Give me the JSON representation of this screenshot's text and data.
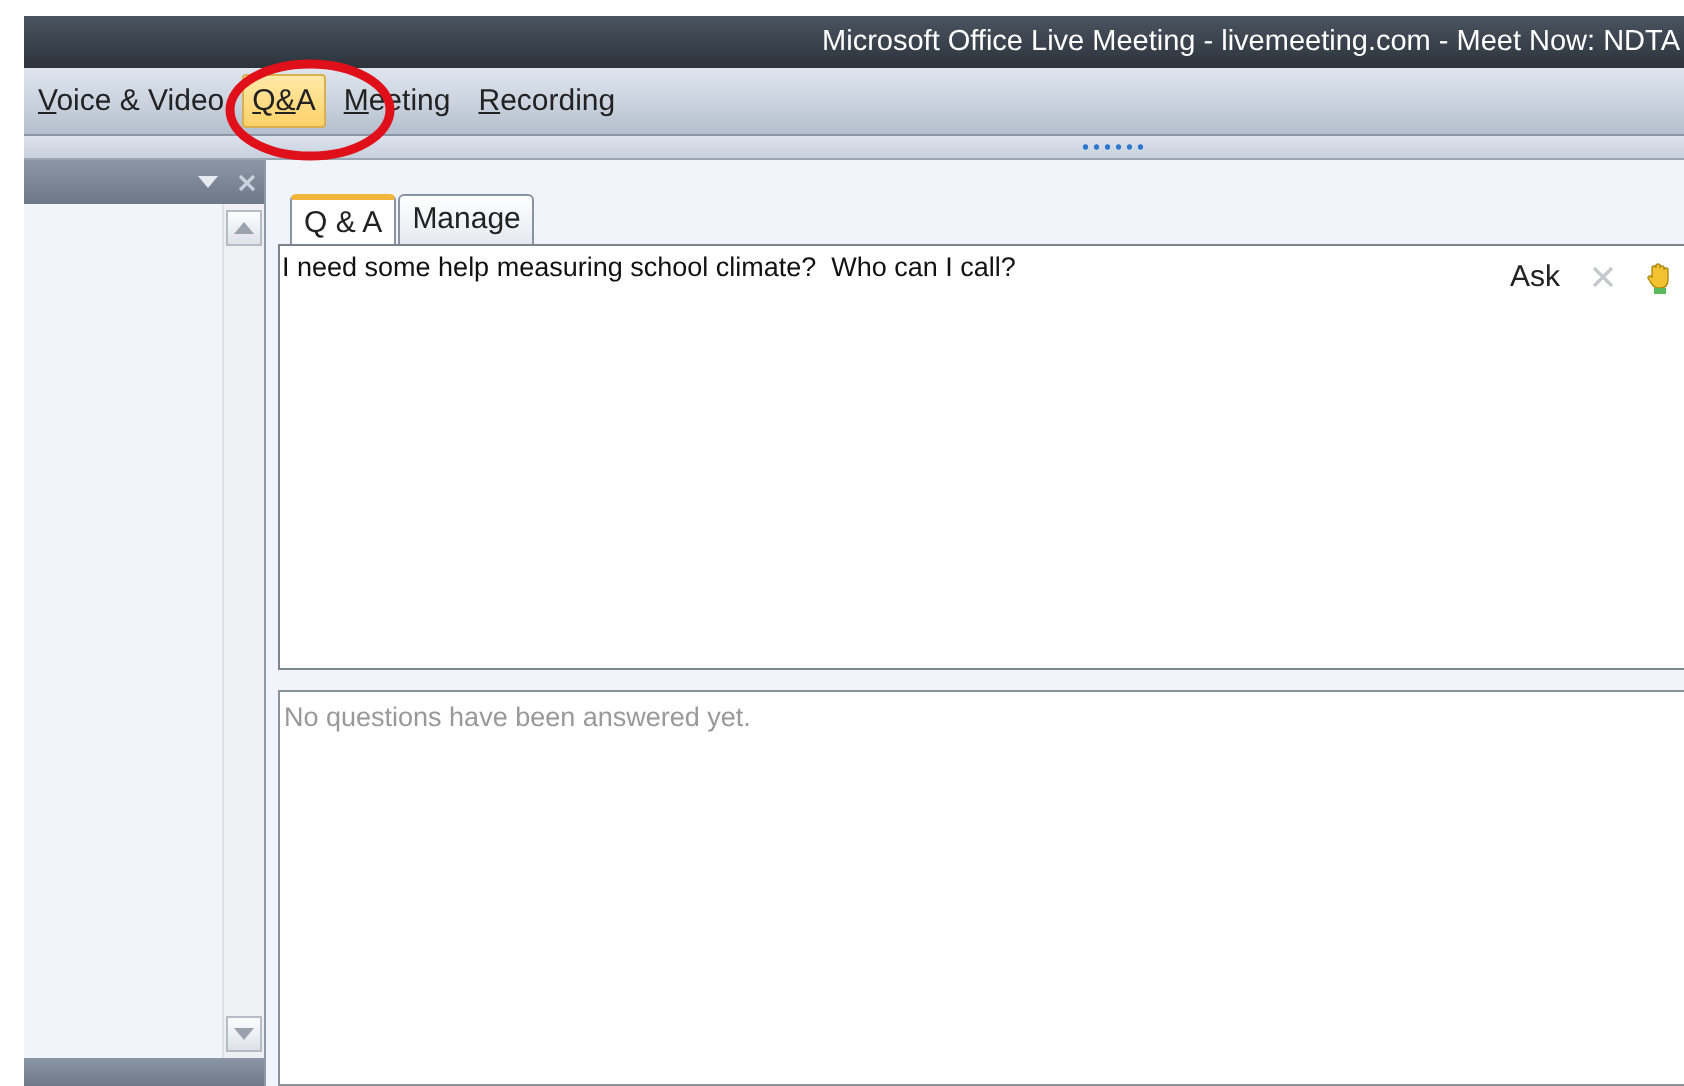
{
  "window": {
    "title": "Microsoft Office Live Meeting - livemeeting.com - Meet Now: NDTA"
  },
  "menu": [
    {
      "label": "Voice & Video",
      "selected": false
    },
    {
      "label": "Q&A",
      "selected": true
    },
    {
      "label": "Meeting",
      "selected": false
    },
    {
      "label": "Recording",
      "selected": false
    }
  ],
  "tabs": [
    {
      "label": "Q & A",
      "selected": true
    },
    {
      "label": "Manage",
      "selected": false
    }
  ],
  "question": {
    "value": "I need some help measuring school climate?  Who can I call?",
    "ask_label": "Ask"
  },
  "answered": {
    "message": "No questions have been answered yet."
  }
}
